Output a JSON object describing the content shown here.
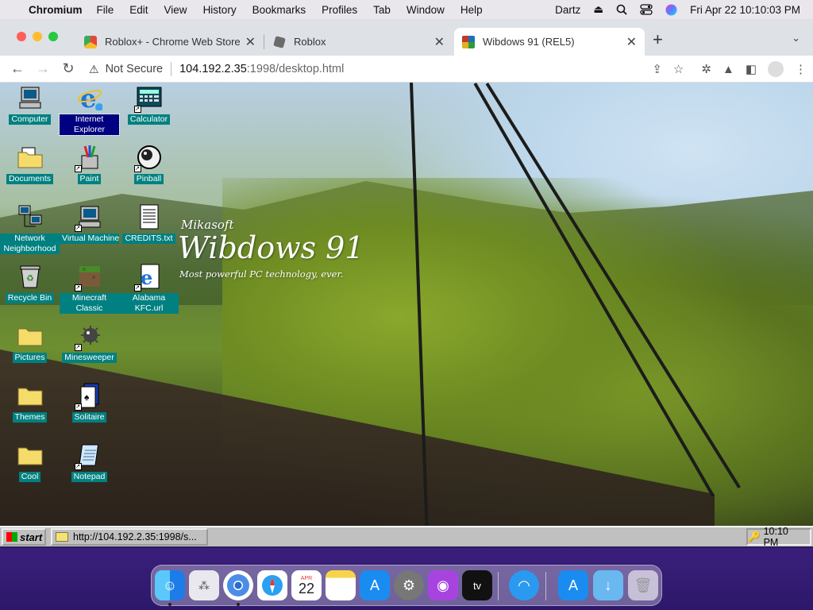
{
  "menubar": {
    "app_name": "Chromium",
    "items": [
      "File",
      "Edit",
      "View",
      "History",
      "Bookmarks",
      "Profiles",
      "Tab",
      "Window",
      "Help"
    ],
    "user": "Dartz",
    "clock": "Fri Apr 22  10:10:03 PM"
  },
  "tabs": [
    {
      "title": "Roblox+ - Chrome Web Store",
      "favicon_color": "#e8453c"
    },
    {
      "title": "Roblox",
      "favicon_color": "#555555"
    },
    {
      "title": "Wibdows 91 (REL5)",
      "favicon_color": "#1f6fb5"
    }
  ],
  "toolbar": {
    "security_label": "Not Secure",
    "url_host": "104.192.2.35",
    "url_path": ":1998/desktop.html"
  },
  "wordmark": {
    "brand": "Mikasoft",
    "name": "Wibdows 91",
    "tagline": "Most powerful PC technology, ever."
  },
  "desktop_icons": [
    {
      "label": "Computer",
      "icon": "computer-icon"
    },
    {
      "label": "Internet Explorer",
      "icon": "internet-explorer-icon"
    },
    {
      "label": "Calculator",
      "icon": "calculator-icon"
    },
    {
      "label": "Documents",
      "icon": "documents-folder-icon"
    },
    {
      "label": "Paint",
      "icon": "paint-icon"
    },
    {
      "label": "Pinball",
      "icon": "pinball-icon"
    },
    {
      "label": "Network Neighborhood",
      "icon": "network-icon"
    },
    {
      "label": "Virtual Machine",
      "icon": "virtual-machine-icon"
    },
    {
      "label": "CREDITS.txt",
      "icon": "text-file-icon"
    },
    {
      "label": "Recycle Bin",
      "icon": "recycle-bin-icon"
    },
    {
      "label": "Minecraft Classic",
      "icon": "minecraft-icon"
    },
    {
      "label": "Alabama KFC.url",
      "icon": "url-shortcut-icon"
    },
    {
      "label": "Pictures",
      "icon": "folder-icon"
    },
    {
      "label": "Minesweeper",
      "icon": "minesweeper-icon"
    },
    {
      "label": "Themes",
      "icon": "folder-icon"
    },
    {
      "label": "Solitaire",
      "icon": "solitaire-icon"
    },
    {
      "label": "Cool",
      "icon": "folder-icon"
    },
    {
      "label": "Notepad",
      "icon": "notepad-icon"
    }
  ],
  "taskbar": {
    "start_label": "start",
    "task_label": "http://104.192.2.35:1998/s...",
    "tray_time": "10:10 PM"
  },
  "dock": {
    "calendar_month": "APR",
    "calendar_day": "22",
    "tv_label": "tv",
    "apps": [
      "finder-icon",
      "launchpad-icon",
      "chromium-icon",
      "safari-icon",
      "calendar-icon",
      "notes-icon",
      "app-store-icon",
      "system-preferences-icon",
      "podcasts-icon",
      "apple-tv-icon",
      "wifi-icon",
      "app-store-icon",
      "downloads-folder-icon",
      "trash-icon"
    ]
  }
}
